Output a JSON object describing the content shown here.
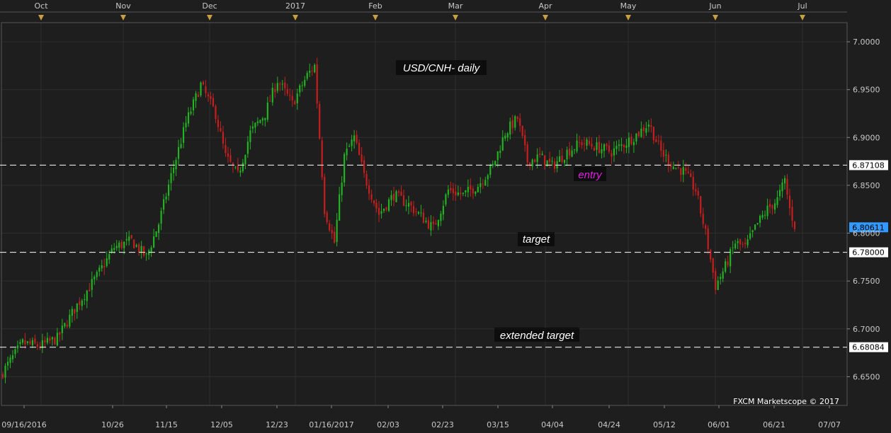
{
  "chart_data": {
    "type": "candlestick",
    "title": "USD/CNH- daily",
    "credit": "FXCM Marketscope © 2017",
    "ylim": [
      6.62,
      7.02
    ],
    "y_ticks": [
      6.65,
      6.7,
      6.75,
      6.8,
      6.85,
      6.9,
      6.95,
      7.0
    ],
    "y_tick_labels": [
      "6.6500",
      "6.7000",
      "6.7500",
      "6.8000",
      "6.8500",
      "6.9000",
      "6.9500",
      "7.0000"
    ],
    "month_labels": [
      "Oct",
      "Nov",
      "Dec",
      "2017",
      "Feb",
      "Mar",
      "Apr",
      "May",
      "Jun",
      "Jul"
    ],
    "date_labels": [
      "09/16/2016",
      "10/26",
      "11/15",
      "12/05",
      "12/23",
      "01/16/2017",
      "02/03",
      "02/23",
      "03/15",
      "04/04",
      "04/24",
      "05/12",
      "06/01",
      "06/21",
      "07/07"
    ],
    "colors": {
      "up": "#22b422",
      "down": "#c81e1e",
      "background": "#1e1e1e",
      "grid": "#2e2e2e",
      "current_price_tag": "#3399ff"
    },
    "levels": [
      {
        "name": "entry",
        "value": 6.87108,
        "tag": "6.87108",
        "label": "entry",
        "label_color": "#e020e0"
      },
      {
        "name": "target",
        "value": 6.78,
        "tag": "6.78000",
        "label": "target",
        "label_color": "#ffffff"
      },
      {
        "name": "extended target",
        "value": 6.68084,
        "tag": "6.68084",
        "label": "extended target",
        "label_color": "#ffffff"
      }
    ],
    "current_price": {
      "value": 6.80611,
      "tag": "6.80611"
    },
    "close_waypoints": [
      [
        0,
        6.655
      ],
      [
        8,
        6.685
      ],
      [
        15,
        6.682
      ],
      [
        22,
        6.69
      ],
      [
        30,
        6.725
      ],
      [
        38,
        6.755
      ],
      [
        45,
        6.785
      ],
      [
        52,
        6.792
      ],
      [
        58,
        6.775
      ],
      [
        63,
        6.81
      ],
      [
        68,
        6.86
      ],
      [
        74,
        6.915
      ],
      [
        80,
        6.955
      ],
      [
        86,
        6.925
      ],
      [
        90,
        6.88
      ],
      [
        95,
        6.86
      ],
      [
        100,
        6.905
      ],
      [
        106,
        6.925
      ],
      [
        111,
        6.96
      ],
      [
        117,
        6.935
      ],
      [
        123,
        6.965
      ],
      [
        126,
        6.975
      ],
      [
        130,
        6.825
      ],
      [
        134,
        6.79
      ],
      [
        138,
        6.88
      ],
      [
        142,
        6.9
      ],
      [
        146,
        6.86
      ],
      [
        152,
        6.82
      ],
      [
        158,
        6.84
      ],
      [
        164,
        6.83
      ],
      [
        170,
        6.815
      ],
      [
        174,
        6.805
      ],
      [
        180,
        6.845
      ],
      [
        186,
        6.84
      ],
      [
        192,
        6.85
      ],
      [
        198,
        6.87
      ],
      [
        203,
        6.905
      ],
      [
        208,
        6.92
      ],
      [
        212,
        6.875
      ],
      [
        217,
        6.88
      ],
      [
        222,
        6.87
      ],
      [
        228,
        6.885
      ],
      [
        234,
        6.895
      ],
      [
        240,
        6.89
      ],
      [
        246,
        6.885
      ],
      [
        252,
        6.895
      ],
      [
        257,
        6.905
      ],
      [
        261,
        6.915
      ],
      [
        266,
        6.885
      ],
      [
        271,
        6.87
      ],
      [
        275,
        6.865
      ],
      [
        280,
        6.845
      ],
      [
        284,
        6.8
      ],
      [
        288,
        6.745
      ],
      [
        292,
        6.765
      ],
      [
        296,
        6.79
      ],
      [
        300,
        6.785
      ],
      [
        305,
        6.81
      ],
      [
        309,
        6.825
      ],
      [
        313,
        6.835
      ],
      [
        316,
        6.855
      ],
      [
        318,
        6.825
      ],
      [
        320,
        6.808
      ]
    ]
  }
}
